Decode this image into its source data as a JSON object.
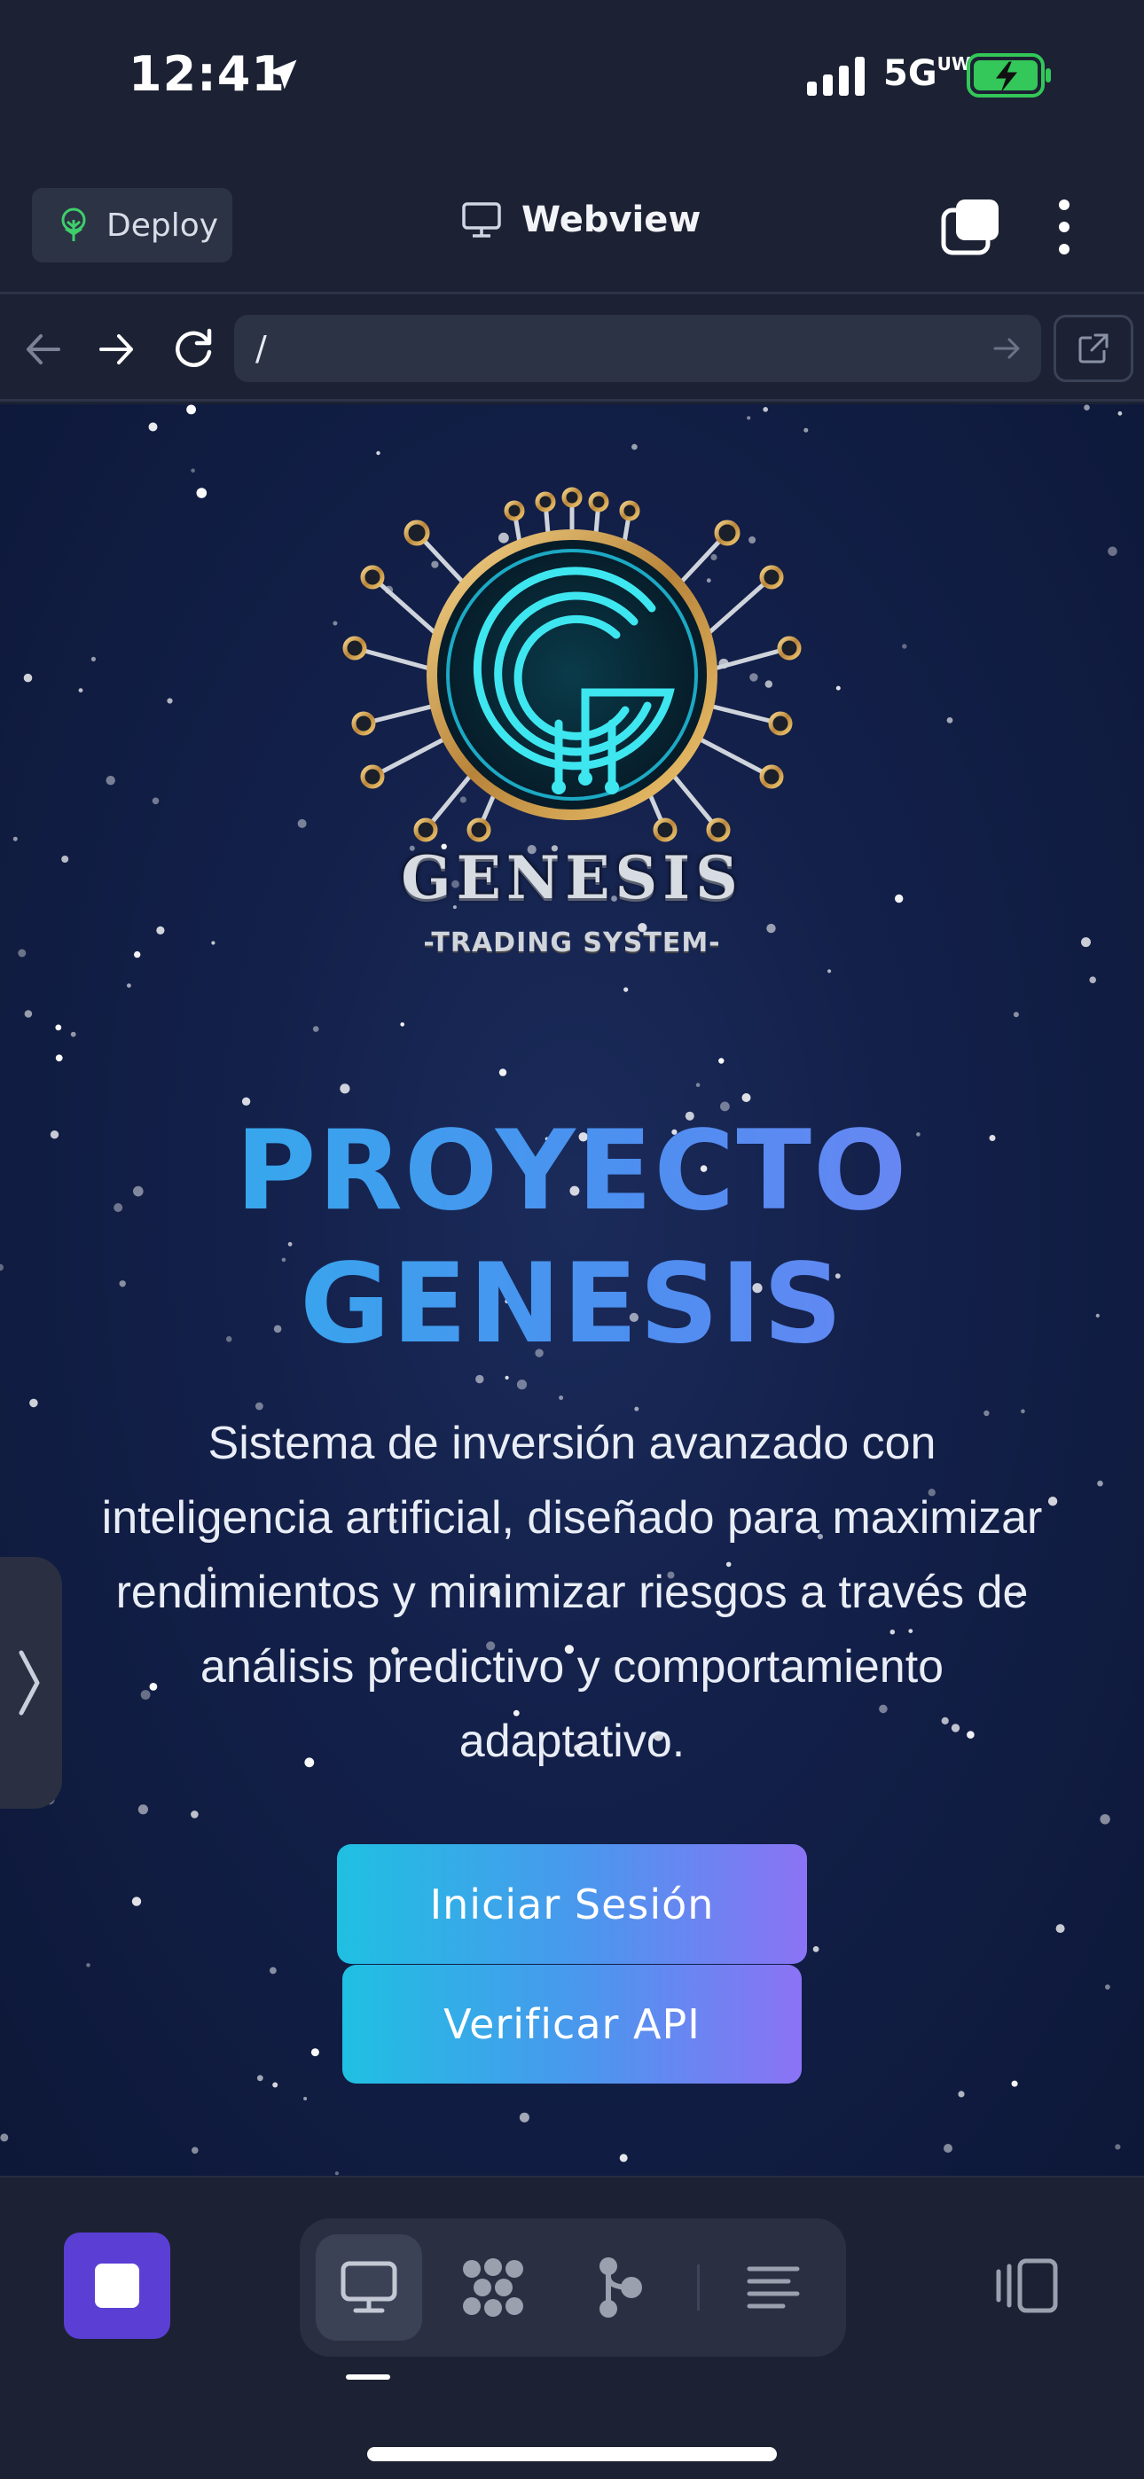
{
  "status_bar": {
    "time": "12:41",
    "network": "5G",
    "network_suffix": "UW",
    "battery_color": "#34c759"
  },
  "header": {
    "deploy_label": "Deploy",
    "title": "Webview"
  },
  "url_bar": {
    "url": "/"
  },
  "page": {
    "brand": "GENESIS",
    "brand_sub": "-TRADING SYSTEM-",
    "title_line1": "PROYECTO",
    "title_line2": "GENESIS",
    "description": "Sistema de inversión avanzado con inteligencia artificial, diseñado para maximizar rendimientos y minimizar riesgos a través de análisis predictivo y comportamiento adaptativo.",
    "login_button": "Iniciar Sesión",
    "verify_button": "Verificar API"
  },
  "bottom_toolbar": {
    "tools": [
      "webview-icon",
      "apps-grid-icon",
      "workflow-icon",
      "console-icon"
    ],
    "active_tool": "webview-icon"
  },
  "colors": {
    "accent_purple": "#5b3fd4",
    "gradient_start": "#1fc0e2",
    "gradient_end": "#8b73f5",
    "background": "#1c2233"
  }
}
